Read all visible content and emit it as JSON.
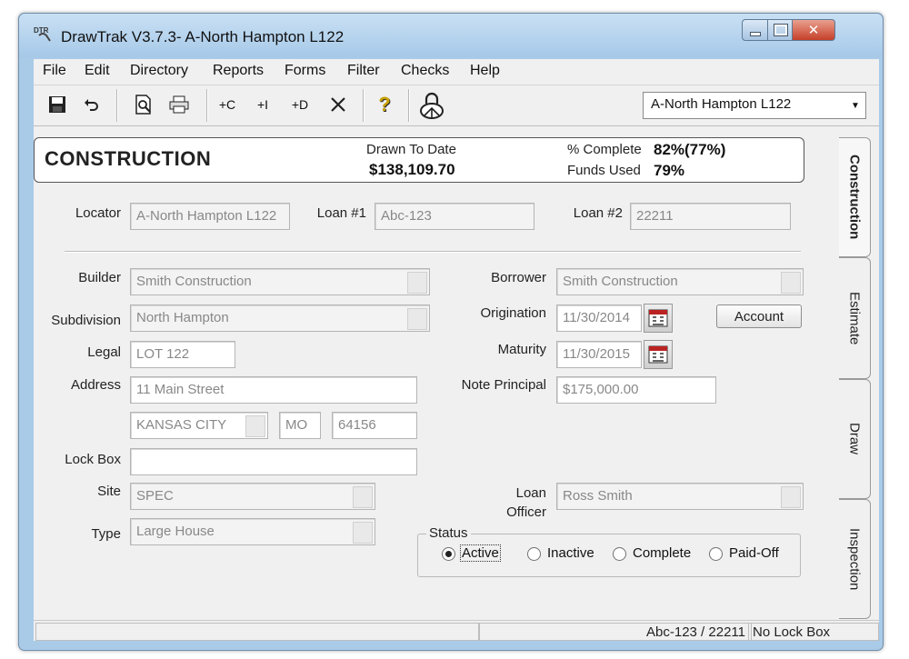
{
  "window": {
    "app_icon_text": "DTR",
    "title": "DrawTrak  V3.7.3- A-North Hampton L122",
    "close_glyph": "✕"
  },
  "menu": [
    "File",
    "Edit",
    "Directory",
    "Reports",
    "Forms",
    "Filter",
    "Checks",
    "Help"
  ],
  "toolbar": {
    "buttons": {
      "save": "save-icon",
      "undo": "undo-icon",
      "preview": "print-preview-icon",
      "print": "printer-icon",
      "add_c": "+C",
      "add_i": "+I",
      "add_d": "+D",
      "delete": "delete-x-icon",
      "help": "?",
      "lock": "lock-icon"
    },
    "project_select": "A-North Hampton L122"
  },
  "header": {
    "title": "CONSTRUCTION",
    "drawn_label": "Drawn To Date",
    "drawn_value": "$138,109.70",
    "complete_label": "% Complete",
    "complete_value": "82%(77%)",
    "funds_label": "Funds Used",
    "funds_value": "79%"
  },
  "tabs": [
    "Construction",
    "Estimate",
    "Draw",
    "Inspection"
  ],
  "form": {
    "locator": {
      "label": "Locator",
      "value": "A-North Hampton L122"
    },
    "loan1": {
      "label": "Loan #1",
      "value": "Abc-123"
    },
    "loan2": {
      "label": "Loan #2",
      "value": "22211"
    },
    "builder": {
      "label": "Builder",
      "value": "Smith Construction"
    },
    "subdivision": {
      "label": "Subdivision",
      "value": "North Hampton"
    },
    "legal": {
      "label": "Legal",
      "value": "LOT 122"
    },
    "address": {
      "label": "Address",
      "street": "11 Main Street",
      "city": "KANSAS  CITY",
      "state": "MO",
      "zip": "64156"
    },
    "lockbox": {
      "label": "Lock Box",
      "value": ""
    },
    "site": {
      "label": "Site",
      "value": "SPEC"
    },
    "type": {
      "label": "Type",
      "value": "Large House"
    },
    "borrower": {
      "label": "Borrower",
      "value": "Smith Construction"
    },
    "origination": {
      "label": "Origination",
      "value": "11/30/2014"
    },
    "maturity": {
      "label": "Maturity",
      "value": "11/30/2015"
    },
    "account_button": "Account",
    "note_principal": {
      "label": "Note Principal",
      "value": "$175,000.00"
    },
    "loan_officer": {
      "label_line1": "Loan",
      "label_line2": "Officer",
      "value": "Ross Smith"
    },
    "status": {
      "label": "Status",
      "options": [
        "Active",
        "Inactive",
        "Complete",
        "Paid-Off"
      ],
      "selected": "Active"
    }
  },
  "statusbar": {
    "loan_ref": "Abc-123 / 22211",
    "lockbox": "No Lock Box"
  }
}
